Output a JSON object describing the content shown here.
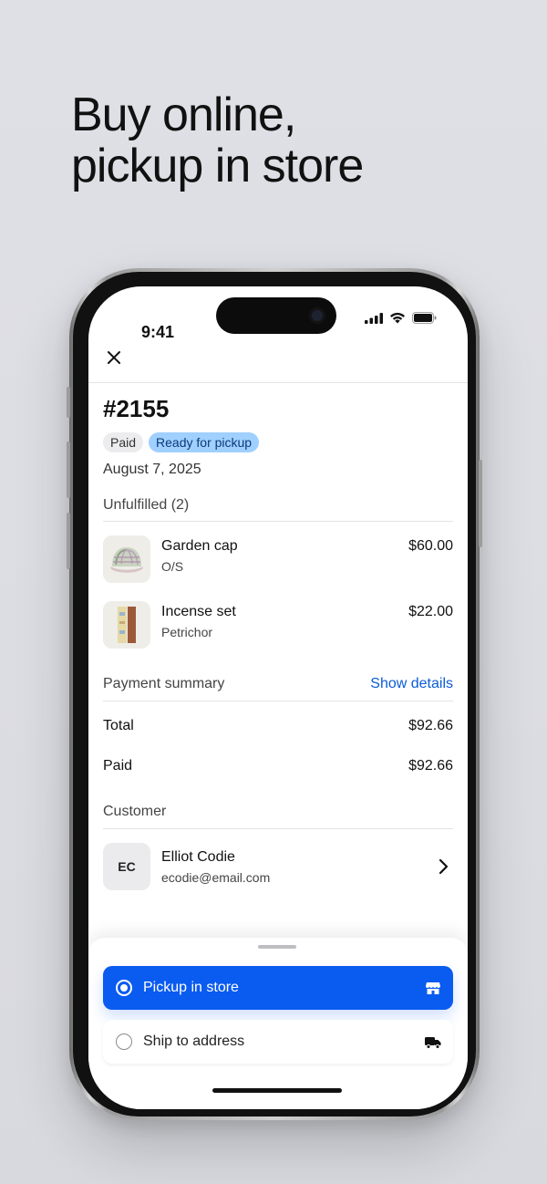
{
  "headline": {
    "line1": "Buy online,",
    "line2": "pickup in store"
  },
  "status_bar": {
    "time": "9:41"
  },
  "order": {
    "number": "#2155",
    "badges": [
      {
        "label": "Paid"
      },
      {
        "label": "Ready for pickup"
      }
    ],
    "date": "August 7, 2025"
  },
  "unfulfilled": {
    "label": "Unfulfilled (2)",
    "items": [
      {
        "name": "Garden cap",
        "variant": "O/S",
        "price": "$60.00"
      },
      {
        "name": "Incense set",
        "variant": "Petrichor",
        "price": "$22.00"
      }
    ]
  },
  "payment_summary": {
    "label": "Payment summary",
    "show_details": "Show details",
    "rows": [
      {
        "label": "Total",
        "value": "$92.66"
      },
      {
        "label": "Paid",
        "value": "$92.66"
      }
    ]
  },
  "customer": {
    "label": "Customer",
    "initials": "EC",
    "name": "Elliot Codie",
    "email": "ecodie@email.com"
  },
  "delivery_options": [
    {
      "label": "Pickup in store",
      "selected": true,
      "icon": "store-icon"
    },
    {
      "label": "Ship to address",
      "selected": false,
      "icon": "truck-icon"
    }
  ],
  "colors": {
    "accent": "#0a5bf0",
    "link": "#0b5cd5",
    "ready_badge_bg": "#9fd0ff",
    "page_bg": "#dfe0e6"
  }
}
